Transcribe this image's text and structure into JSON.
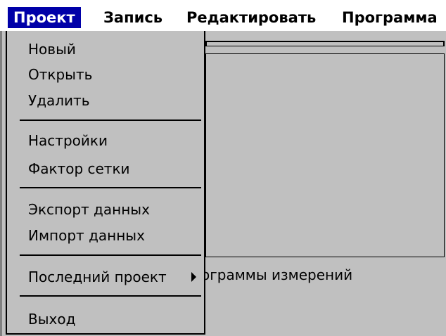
{
  "menubar": {
    "items": [
      "Проект",
      "Запись",
      "Редактировать",
      "Программа"
    ]
  },
  "dropdown": {
    "items": [
      "Новый",
      "Открыть",
      "Удалить",
      "Настройки",
      "Фактор сетки",
      "Экспорт данных",
      "Импорт данных",
      "Последний проект",
      "Выход"
    ]
  },
  "background": {
    "partial_text": "ограммы измерений"
  }
}
